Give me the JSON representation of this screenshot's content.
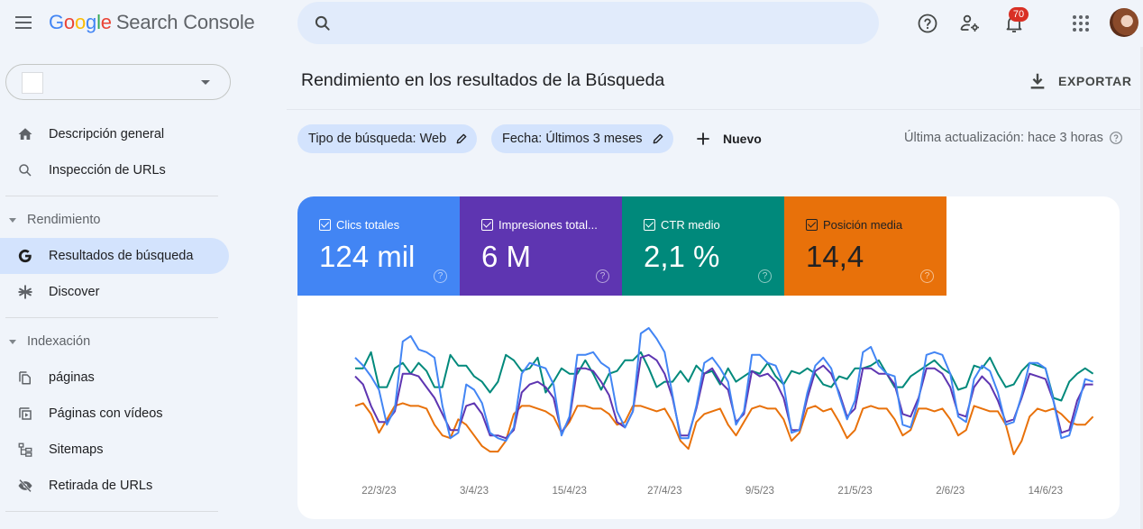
{
  "app": {
    "logo_letters": [
      "G",
      "o",
      "o",
      "g",
      "l",
      "e"
    ],
    "product_name": "Search Console"
  },
  "topbar": {
    "search_placeholder": "",
    "search_value": "",
    "icons": [
      "help-icon",
      "manage-users-icon",
      "notifications-icon",
      "apps-grid-icon",
      "account-avatar"
    ],
    "notification_count": "70"
  },
  "sidebar": {
    "property_selector_value": "",
    "items_top": [
      {
        "label": "Descripción general",
        "icon": "home-icon"
      },
      {
        "label": "Inspección de URLs",
        "icon": "search-icon"
      }
    ],
    "sections": [
      {
        "label": "Rendimiento",
        "items": [
          {
            "label": "Resultados de búsqueda",
            "icon": "google-g-icon",
            "active": true
          },
          {
            "label": "Discover",
            "icon": "asterisk-icon",
            "active": false
          }
        ]
      },
      {
        "label": "Indexación",
        "items": [
          {
            "label": "páginas",
            "icon": "pages-icon"
          },
          {
            "label": "Páginas con vídeos",
            "icon": "video-pages-icon"
          },
          {
            "label": "Sitemaps",
            "icon": "sitemap-icon"
          },
          {
            "label": "Retirada de URLs",
            "icon": "visibility-off-icon"
          }
        ]
      }
    ]
  },
  "main": {
    "title": "Rendimiento en los resultados de la Búsqueda",
    "export_label": "EXPORTAR",
    "filters": [
      {
        "label": "Tipo de búsqueda: Web"
      },
      {
        "label": "Fecha: Últimos 3 meses"
      }
    ],
    "new_filter_label": "Nuevo",
    "last_update": "Última actualización: hace 3 horas",
    "metrics": [
      {
        "label": "Clics totales",
        "value": "124 mil",
        "color": "#4285f4",
        "checked": true
      },
      {
        "label": "Impresiones total...",
        "value": "6 M",
        "color": "#5e35b1",
        "checked": true
      },
      {
        "label": "CTR medio",
        "value": "2,1 %",
        "color": "#00897b",
        "checked": true
      },
      {
        "label": "Posición media",
        "value": "14,4",
        "color": "#e8710a",
        "checked": true
      }
    ]
  },
  "chart_data": {
    "type": "line",
    "title": "",
    "xlabel": "",
    "ylabel": "",
    "y_axis_visible": false,
    "y_scale_note": "No y-axis shown; each series recorded as relative level 0-100 (100 = top of plot area)",
    "ylim": [
      0,
      100
    ],
    "grid": false,
    "legend": "metric cards above chart",
    "x_tick_labels": [
      "22/3/23",
      "3/4/23",
      "15/4/23",
      "27/4/23",
      "9/5/23",
      "21/5/23",
      "2/6/23",
      "14/6/23"
    ],
    "x_tick_indices": [
      3,
      15,
      27,
      39,
      51,
      63,
      75,
      87
    ],
    "x_start": "19/3/23",
    "point_count": 92,
    "series": [
      {
        "name": "Clics totales",
        "color": "#4285f4",
        "values": [
          78,
          72,
          64,
          54,
          28,
          40,
          90,
          94,
          84,
          82,
          78,
          42,
          18,
          22,
          58,
          54,
          44,
          22,
          18,
          16,
          26,
          66,
          74,
          72,
          70,
          58,
          20,
          34,
          80,
          80,
          82,
          74,
          70,
          38,
          26,
          38,
          96,
          100,
          92,
          82,
          50,
          18,
          18,
          42,
          74,
          78,
          70,
          60,
          28,
          38,
          80,
          80,
          74,
          72,
          58,
          22,
          24,
          52,
          72,
          78,
          70,
          50,
          32,
          46,
          82,
          86,
          72,
          66,
          64,
          28,
          26,
          46,
          80,
          82,
          80,
          66,
          34,
          30,
          62,
          72,
          68,
          52,
          28,
          30,
          50,
          74,
          74,
          70,
          46,
          18,
          20,
          40,
          62,
          60
        ]
      },
      {
        "name": "Impresiones totales",
        "color": "#5e35b1",
        "values": [
          64,
          58,
          42,
          30,
          30,
          38,
          66,
          66,
          64,
          56,
          48,
          36,
          24,
          24,
          42,
          44,
          36,
          20,
          20,
          18,
          24,
          52,
          58,
          60,
          56,
          48,
          22,
          32,
          70,
          70,
          68,
          60,
          50,
          30,
          26,
          38,
          78,
          80,
          76,
          66,
          48,
          20,
          20,
          40,
          66,
          70,
          60,
          54,
          30,
          36,
          68,
          64,
          66,
          60,
          48,
          24,
          24,
          48,
          68,
          72,
          66,
          52,
          34,
          40,
          70,
          70,
          66,
          66,
          58,
          36,
          34,
          48,
          70,
          70,
          66,
          56,
          36,
          34,
          56,
          64,
          58,
          46,
          30,
          32,
          48,
          66,
          64,
          62,
          46,
          22,
          24,
          46,
          58,
          58
        ]
      },
      {
        "name": "CTR medio",
        "color": "#00897b",
        "values": [
          70,
          70,
          82,
          56,
          56,
          70,
          74,
          66,
          74,
          68,
          56,
          56,
          80,
          72,
          72,
          64,
          60,
          52,
          60,
          80,
          76,
          68,
          70,
          78,
          52,
          60,
          70,
          66,
          66,
          76,
          66,
          54,
          66,
          68,
          76,
          76,
          82,
          70,
          56,
          60,
          60,
          68,
          60,
          72,
          66,
          68,
          58,
          70,
          60,
          64,
          68,
          66,
          74,
          64,
          58,
          68,
          66,
          70,
          66,
          58,
          56,
          64,
          62,
          70,
          70,
          72,
          76,
          66,
          56,
          56,
          64,
          68,
          72,
          76,
          70,
          66,
          54,
          56,
          72,
          70,
          78,
          66,
          56,
          58,
          68,
          74,
          72,
          70,
          48,
          46,
          60,
          66,
          70,
          66
        ]
      },
      {
        "name": "Posición media",
        "color": "#e8710a",
        "values": [
          42,
          44,
          36,
          22,
          32,
          42,
          44,
          42,
          42,
          40,
          28,
          20,
          18,
          32,
          28,
          20,
          12,
          8,
          8,
          16,
          36,
          42,
          42,
          40,
          38,
          34,
          22,
          30,
          42,
          42,
          40,
          40,
          36,
          28,
          30,
          42,
          42,
          40,
          38,
          40,
          30,
          16,
          10,
          30,
          36,
          38,
          40,
          28,
          20,
          30,
          40,
          42,
          40,
          40,
          32,
          16,
          22,
          40,
          42,
          38,
          40,
          30,
          18,
          24,
          40,
          42,
          40,
          40,
          32,
          20,
          24,
          40,
          40,
          38,
          40,
          32,
          20,
          24,
          42,
          40,
          38,
          38,
          28,
          6,
          16,
          34,
          40,
          38,
          40,
          36,
          30,
          28,
          28,
          34
        ]
      }
    ]
  }
}
